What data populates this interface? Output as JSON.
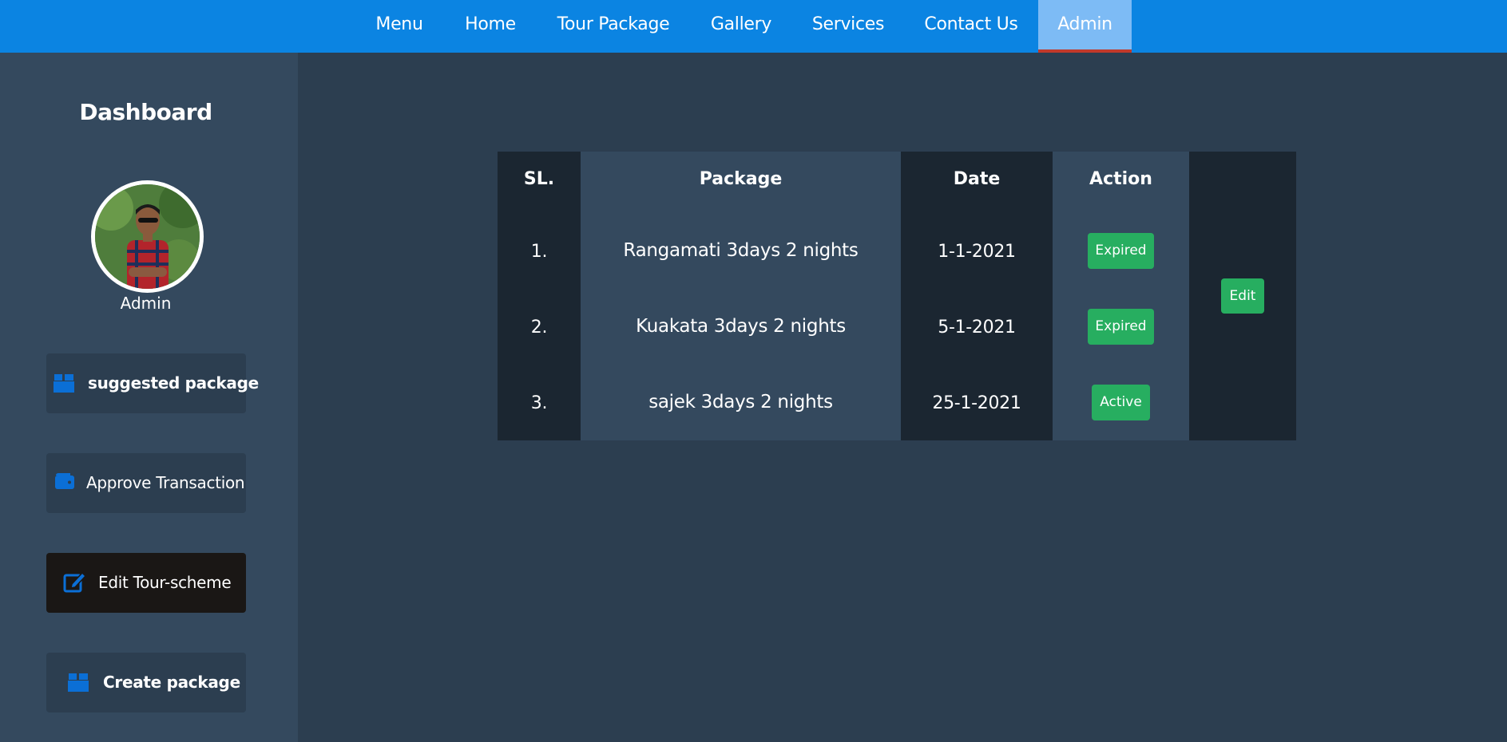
{
  "nav": {
    "items": [
      "Menu",
      "Home",
      "Tour Package",
      "Gallery",
      "Services",
      "Contact Us",
      "Admin"
    ],
    "active": "Admin"
  },
  "sidebar": {
    "title": "Dashboard",
    "avatar_name": "Admin",
    "buttons": [
      {
        "label": "suggested package",
        "icon": "box-icon"
      },
      {
        "label": "Approve Transaction",
        "icon": "wallet-icon"
      },
      {
        "label": "Edit Tour-scheme",
        "icon": "edit-icon"
      },
      {
        "label": "Create package",
        "icon": "box-icon"
      }
    ]
  },
  "table": {
    "headers": [
      "SL.",
      "Package",
      "Date",
      "Action"
    ],
    "rows": [
      {
        "sl": "1.",
        "package": "Rangamati 3days 2 nights",
        "date": "1-1-2021",
        "status": "Expired"
      },
      {
        "sl": "2.",
        "package": "Kuakata 3days 2 nights",
        "date": "5-1-2021",
        "status": "Expired"
      },
      {
        "sl": "3.",
        "package": "sajek 3days 2 nights",
        "date": "25-1-2021",
        "status": "Active"
      }
    ],
    "edit_label": "Edit"
  },
  "colors": {
    "nav_bg": "#0b84e2",
    "nav_active_bg": "#7dbbf5",
    "nav_active_underline": "#c0392b",
    "page_bg": "#2c3e50",
    "sidebar_bg": "#34495e",
    "table_dark": "#1b2631",
    "badge_green": "#27ae60",
    "icon_blue": "#0b6fd6"
  }
}
